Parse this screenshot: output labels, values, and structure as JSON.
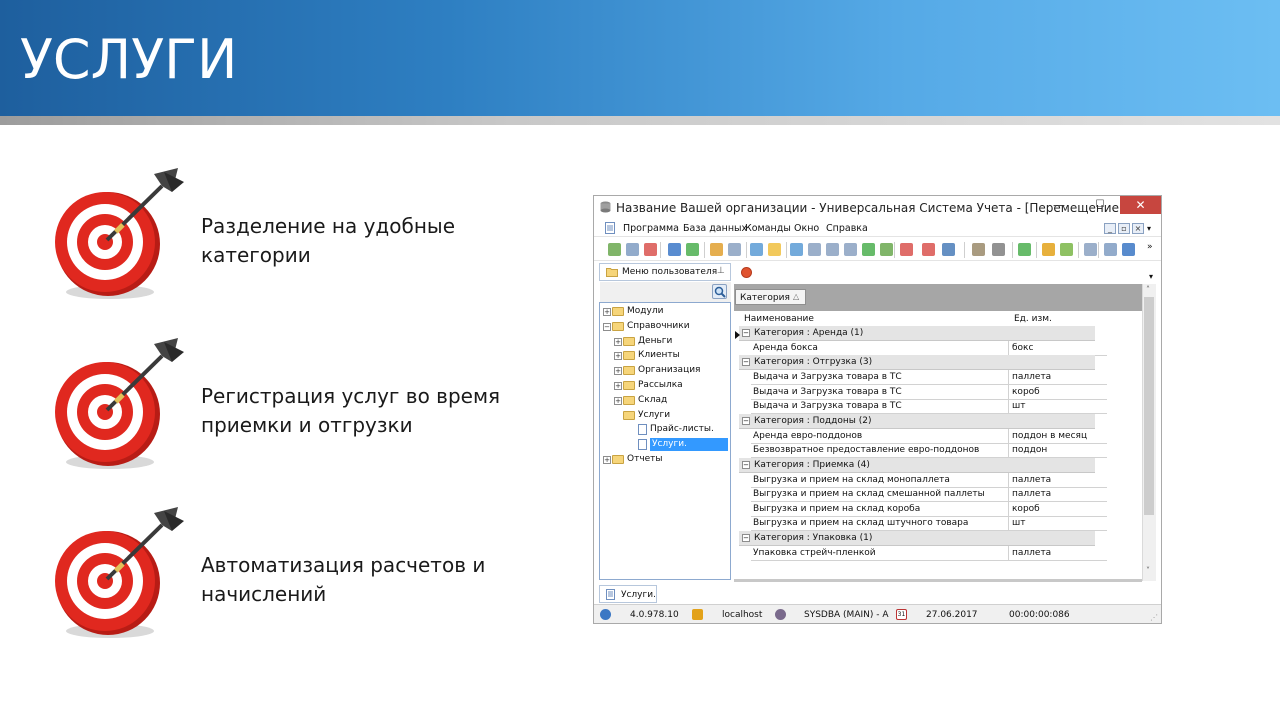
{
  "slide": {
    "title": "УСЛУГИ",
    "bullets": [
      {
        "text_line1": "Разделение на удобные",
        "text_line2": "категории"
      },
      {
        "text_line1": "Регистрация услуг во время",
        "text_line2": "приемки и отгрузки"
      },
      {
        "text_line1": "Автоматизация расчетов и",
        "text_line2": "начислений"
      }
    ],
    "colors": {
      "header_dark": "#1e5f9e",
      "header_light": "#6cbef3",
      "target_red": "#d7261e"
    }
  },
  "window": {
    "title": "Название Вашей организации - Универсальная Система Учета - [Перемещение - Р...",
    "controls": {
      "minimize": "—",
      "maximize": "☐",
      "close": "✕"
    },
    "menu": [
      "Программа",
      "База данных",
      "Команды",
      "Окно",
      "Справка"
    ],
    "toolbar_icons": [
      "new-icon",
      "copy-icon",
      "delete-icon",
      "search-icon",
      "refresh-icon",
      "filter-icon",
      "filter-clear-icon",
      "import-icon",
      "note-icon",
      "move-left-icon",
      "collapse-icon",
      "expand-icon",
      "up-icon",
      "export-icon",
      "report-icon",
      "window-icon",
      "window2-icon",
      "chart-icon",
      "tools-icon",
      "settings-icon",
      "excel-icon",
      "lock-icon",
      "users-icon",
      "calendar-icon",
      "print-icon",
      "share-icon"
    ]
  },
  "left_panel": {
    "tab_label": "Меню пользователя",
    "tree": [
      {
        "label": "Модули",
        "level": 0,
        "type": "folder",
        "expander": "+"
      },
      {
        "label": "Справочники",
        "level": 0,
        "type": "folder",
        "expander": "−"
      },
      {
        "label": "Деньги",
        "level": 1,
        "type": "folder",
        "expander": "+"
      },
      {
        "label": "Клиенты",
        "level": 1,
        "type": "folder",
        "expander": "+"
      },
      {
        "label": "Организация",
        "level": 1,
        "type": "folder",
        "expander": "+"
      },
      {
        "label": "Рассылка",
        "level": 1,
        "type": "folder",
        "expander": "+"
      },
      {
        "label": "Склад",
        "level": 1,
        "type": "folder",
        "expander": "+"
      },
      {
        "label": "Услуги",
        "level": 1,
        "type": "folder",
        "expander": ""
      },
      {
        "label": "Прайс-листы.",
        "level": 2,
        "type": "doc",
        "expander": ""
      },
      {
        "label": "Услуги.",
        "level": 2,
        "type": "doc",
        "expander": "",
        "selected": true
      },
      {
        "label": "Отчеты",
        "level": 0,
        "type": "folder",
        "expander": "+"
      }
    ]
  },
  "grid": {
    "group_chip": "Категория",
    "group_sort_glyph": "△",
    "columns": [
      "Наименование",
      "Ед. изм."
    ],
    "rows": [
      {
        "kind": "cat",
        "label": "Категория : Аренда (1)"
      },
      {
        "kind": "data",
        "name": "Аренда бокса",
        "unit": "бокс"
      },
      {
        "kind": "cat",
        "label": "Категория : Отгрузка (3)"
      },
      {
        "kind": "data",
        "name": "Выдача и Загрузка товара в ТС",
        "unit": "паллета"
      },
      {
        "kind": "data",
        "name": "Выдача и Загрузка товара в ТС",
        "unit": "короб"
      },
      {
        "kind": "data",
        "name": "Выдача и Загрузка товара в ТС",
        "unit": "шт"
      },
      {
        "kind": "cat",
        "label": "Категория : Поддоны (2)"
      },
      {
        "kind": "data",
        "name": "Аренда евро-поддонов",
        "unit": "поддон в месяц"
      },
      {
        "kind": "data",
        "name": "Безвозвратное предоставление евро-поддонов",
        "unit": "поддон"
      },
      {
        "kind": "cat",
        "label": "Категория : Приемка (4)"
      },
      {
        "kind": "data",
        "name": "Выгрузка и прием на склад монопаллета",
        "unit": "паллета"
      },
      {
        "kind": "data",
        "name": "Выгрузка и прием на склад смешанной паллеты",
        "unit": "паллета"
      },
      {
        "kind": "data",
        "name": "Выгрузка и прием на склад короба",
        "unit": "короб"
      },
      {
        "kind": "data",
        "name": "Выгрузка и прием на склад штучного товара",
        "unit": "шт"
      },
      {
        "kind": "cat",
        "label": "Категория : Упаковка (1)"
      },
      {
        "kind": "data",
        "name": "Упаковка стрейч-пленкой",
        "unit": "паллета"
      }
    ]
  },
  "bottom_tab": "Услуги.",
  "status": {
    "version": "4.0.978.10",
    "host": "localhost",
    "user": "SYSDBA (MAIN) - A",
    "calendar_day": "31",
    "date": "27.06.2017",
    "timer": "00:00:00:086"
  }
}
